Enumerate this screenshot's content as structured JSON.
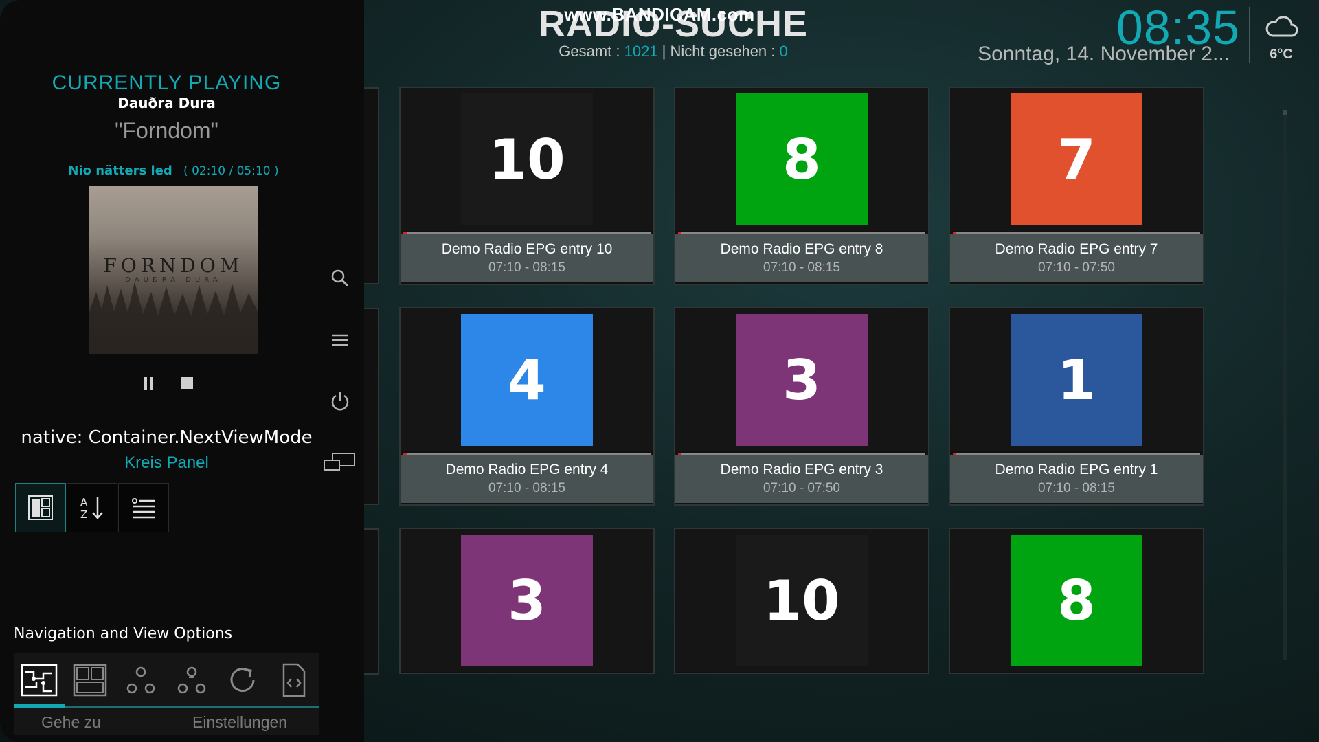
{
  "watermark": "www.BANDICAM.com",
  "header": {
    "title": "RADIO-SUCHE",
    "total_label": "Gesamt :",
    "total_value": "1021",
    "separator": "|",
    "unseen_label": "Nicht gesehen :",
    "unseen_value": "0",
    "clock": "08:35",
    "date": "Sonntag, 14. November 2...",
    "weather_icon": "cloud-icon",
    "temperature": "6°C"
  },
  "now_playing": {
    "heading": "CURRENTLY PLAYING",
    "artist": "Dauðra Dura",
    "album": "\"Forndom\"",
    "track": "Nio nätters led",
    "time": "( 02:10 / 05:10 )",
    "album_art_text": "FORNDOM",
    "album_art_subtext": "DAUÐRA DURA"
  },
  "view_options": {
    "view_mode_name": "native: Container.NextViewMode",
    "view_mode_value": "Kreis Panel",
    "buttons": [
      {
        "icon": "layout-icon"
      },
      {
        "icon": "sort-az-icon"
      },
      {
        "icon": "list-icon"
      }
    ]
  },
  "side_icons": [
    "search-icon",
    "menu-icon",
    "power-icon",
    "screens-icon"
  ],
  "navigation": {
    "title": "Navigation and View Options",
    "icons": [
      "nav-map-icon",
      "nav-panel-icon",
      "group-icon",
      "group-alt-icon",
      "refresh-icon",
      "code-file-icon"
    ],
    "goto_label": "Gehe zu",
    "settings_label": "Einstellungen"
  },
  "grid": {
    "row1": [
      {
        "number": "10",
        "color": "#1a1a1a",
        "title": "Demo Radio EPG entry 10",
        "time": "07:10 - 08:15"
      },
      {
        "number": "8",
        "color": "#00a310",
        "title": "Demo Radio EPG entry 8",
        "time": "07:10 - 08:15"
      },
      {
        "number": "7",
        "color": "#e2512d",
        "title": "Demo Radio EPG entry 7",
        "time": "07:10 - 07:50"
      }
    ],
    "row2": [
      {
        "number": "4",
        "color": "#2d87e8",
        "title": "Demo Radio EPG entry 4",
        "time": "07:10 - 08:15"
      },
      {
        "number": "3",
        "color": "#7e3577",
        "title": "Demo Radio EPG entry 3",
        "time": "07:10 - 07:50"
      },
      {
        "number": "1",
        "color": "#2b579c",
        "title": "Demo Radio EPG entry 1",
        "time": "07:10 - 08:15"
      }
    ],
    "row3": [
      {
        "number": "3",
        "color": "#7e3577"
      },
      {
        "number": "10",
        "color": "#1a1a1a"
      },
      {
        "number": "8",
        "color": "#00a310"
      }
    ]
  },
  "colors": {
    "accent": "#12a9b4",
    "progress_marker": "#e02020"
  }
}
